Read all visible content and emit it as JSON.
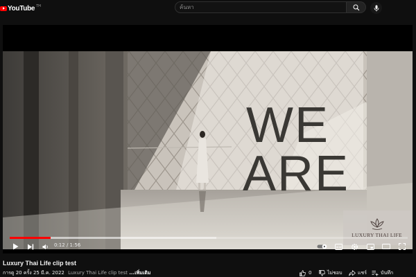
{
  "header": {
    "logo_text": "YouTube",
    "logo_tm": "TH",
    "search_placeholder": "ค้นหา"
  },
  "player": {
    "overlay_text": "WE ARE",
    "watermark_text": "LUXURY THAI LIFE",
    "current_time": "0:12",
    "duration": "1:56",
    "time_display": "0:12 / 1:56",
    "progress_fraction": 0.103,
    "buffered_fraction": 0.52,
    "accent_color": "#ff0000"
  },
  "video_info": {
    "title": "Luxury Thai Life clip test",
    "views": "การดู 20 ครั้ง",
    "date": "25 มี.ค. 2022",
    "description_snippet": "Luxury Thai Life clip test",
    "more_label": "...เพิ่มเติม"
  },
  "actions": {
    "like_count": "0",
    "dislike_label": "ไม่ชอบ",
    "share_label": "แชร์",
    "save_label": "บันทึก"
  }
}
